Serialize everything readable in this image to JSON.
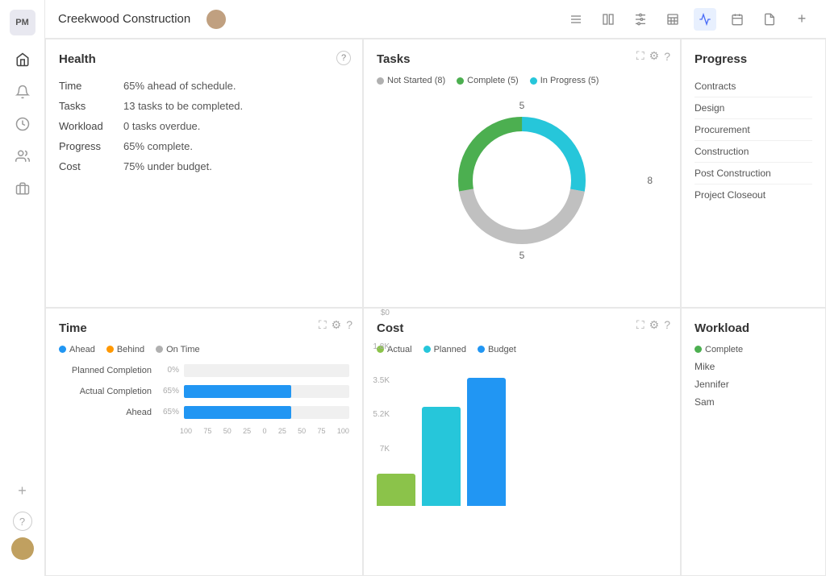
{
  "app": {
    "logo_text": "PM",
    "title": "Creekwood Construction"
  },
  "topbar": {
    "icons": [
      "≡",
      "∥",
      "≡",
      "▦",
      "√",
      "▣",
      "▤",
      "+"
    ],
    "active_icon_index": 4
  },
  "sidebar": {
    "icons": [
      "🏠",
      "🔔",
      "🕐",
      "👥",
      "💼"
    ]
  },
  "health": {
    "title": "Health",
    "rows": [
      {
        "label": "Time",
        "value": "65% ahead of schedule."
      },
      {
        "label": "Tasks",
        "value": "13 tasks to be completed."
      },
      {
        "label": "Workload",
        "value": "0 tasks overdue."
      },
      {
        "label": "Progress",
        "value": "65% complete."
      },
      {
        "label": "Cost",
        "value": "75% under budget."
      }
    ]
  },
  "tasks": {
    "title": "Tasks",
    "legend": [
      {
        "label": "Not Started (8)",
        "color": "#b0b0b0"
      },
      {
        "label": "Complete (5)",
        "color": "#4caf50"
      },
      {
        "label": "In Progress (5)",
        "color": "#26c6da"
      }
    ],
    "donut": {
      "not_started": 8,
      "complete": 5,
      "in_progress": 5,
      "labels": {
        "top": "5",
        "right": "8",
        "bottom": "5"
      }
    }
  },
  "progress": {
    "title": "Progress",
    "items": [
      "Contracts",
      "Design",
      "Procurement",
      "Construction",
      "Post Construction",
      "Project Closeout"
    ]
  },
  "time": {
    "title": "Time",
    "legend": [
      {
        "label": "Ahead",
        "color": "#2196f3"
      },
      {
        "label": "Behind",
        "color": "#ff9800"
      },
      {
        "label": "On Time",
        "color": "#b0b0b0"
      }
    ],
    "bars": [
      {
        "label": "Planned Completion",
        "pct": 0,
        "pct_label": "0%",
        "color": "#b0b0b0"
      },
      {
        "label": "Actual Completion",
        "pct": 65,
        "pct_label": "65%",
        "color": "#2196f3"
      },
      {
        "label": "Ahead",
        "pct": 65,
        "pct_label": "65%",
        "color": "#2196f3"
      }
    ],
    "axis_labels": [
      "100",
      "75",
      "50",
      "25",
      "0",
      "25",
      "50",
      "75",
      "100"
    ]
  },
  "cost": {
    "title": "Cost",
    "legend": [
      {
        "label": "Actual",
        "color": "#8bc34a"
      },
      {
        "label": "Planned",
        "color": "#26c6da"
      },
      {
        "label": "Budget",
        "color": "#2196f3"
      }
    ],
    "y_labels": [
      "7K",
      "5.2K",
      "3.5K",
      "1.8K",
      "$0"
    ],
    "bars": [
      {
        "label": "Actual",
        "height_pct": 22,
        "color": "#8bc34a"
      },
      {
        "label": "Planned",
        "height_pct": 68,
        "color": "#26c6da"
      },
      {
        "label": "Budget",
        "height_pct": 88,
        "color": "#2196f3"
      }
    ]
  },
  "workload": {
    "title": "Workload",
    "legend": [
      {
        "label": "Complete",
        "color": "#4caf50"
      }
    ],
    "people": [
      "Mike",
      "Jennifer",
      "Sam"
    ]
  }
}
